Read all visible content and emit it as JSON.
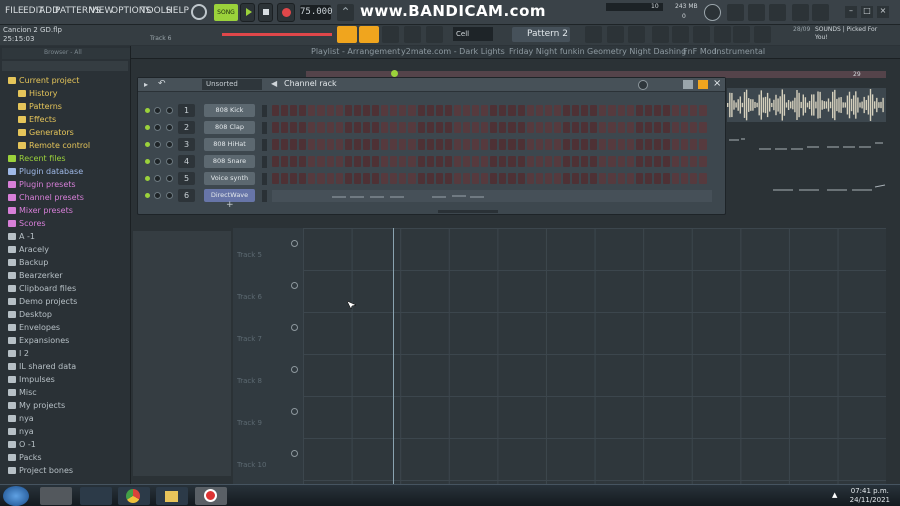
{
  "menu": {
    "items": [
      "FILE",
      "EDIT",
      "ADD",
      "PATTERNS",
      "VIEW",
      "OPTIONS",
      "TOOLS",
      "HELP"
    ]
  },
  "toolbar": {
    "mode": "SONG",
    "tempo": "75.000",
    "watermark": "www.BANDICAM.com",
    "cpu": "10",
    "ram": "243 MB",
    "ram2": "0",
    "pattern": "Pattern 2",
    "snap": "Cell"
  },
  "song": {
    "filename": "Cancion 2 GD.flp",
    "time": "25:15:03",
    "track": "Track 6"
  },
  "news": {
    "count": "28/09",
    "text": "SOUNDS | Picked For You!"
  },
  "browser": {
    "header": "Browser - All",
    "items": [
      {
        "label": "Current project",
        "color": "#e5c55a"
      },
      {
        "label": "History",
        "color": "#e5c55a"
      },
      {
        "label": "Patterns",
        "color": "#e5c55a"
      },
      {
        "label": "Effects",
        "color": "#e5c55a"
      },
      {
        "label": "Generators",
        "color": "#e5c55a"
      },
      {
        "label": "Remote control",
        "color": "#e5c55a"
      },
      {
        "label": "Recent files",
        "color": "#9bd23b"
      },
      {
        "label": "Plugin database",
        "color": "#9fb9e8"
      },
      {
        "label": "Plugin presets",
        "color": "#d77fd8"
      },
      {
        "label": "Channel presets",
        "color": "#d77fd8"
      },
      {
        "label": "Mixer presets",
        "color": "#d77fd8"
      },
      {
        "label": "Scores",
        "color": "#d77fd8"
      },
      {
        "label": "A -1",
        "color": "#b7c0c6"
      },
      {
        "label": "Aracely",
        "color": "#b7c0c6"
      },
      {
        "label": "Backup",
        "color": "#b7c0c6"
      },
      {
        "label": "Bearzerker",
        "color": "#b7c0c6"
      },
      {
        "label": "Clipboard files",
        "color": "#b7c0c6"
      },
      {
        "label": "Demo projects",
        "color": "#b7c0c6"
      },
      {
        "label": "Desktop",
        "color": "#b7c0c6"
      },
      {
        "label": "Envelopes",
        "color": "#b7c0c6"
      },
      {
        "label": "Expansiones",
        "color": "#b7c0c6"
      },
      {
        "label": "I 2",
        "color": "#b7c0c6"
      },
      {
        "label": "IL shared data",
        "color": "#b7c0c6"
      },
      {
        "label": "Impulses",
        "color": "#b7c0c6"
      },
      {
        "label": "Misc",
        "color": "#b7c0c6"
      },
      {
        "label": "My projects",
        "color": "#b7c0c6"
      },
      {
        "label": "nya",
        "color": "#b7c0c6"
      },
      {
        "label": "nya",
        "color": "#b7c0c6"
      },
      {
        "label": "O -1",
        "color": "#b7c0c6"
      },
      {
        "label": "Packs",
        "color": "#b7c0c6"
      },
      {
        "label": "Project bones",
        "color": "#b7c0c6"
      }
    ]
  },
  "playlist": {
    "title": "Playlist - Arrangement",
    "tabs": [
      "y2mate.com - Dark Lights",
      "Friday Night funkin",
      "Geometry Night Dashing",
      "FnF Mod",
      "Instrumental"
    ],
    "bar_end": "29",
    "tracks": [
      "Track 5",
      "Track 6",
      "Track 7",
      "Track 8",
      "Track 9",
      "Track 10"
    ]
  },
  "rack": {
    "title": "Channel rack",
    "filter": "Unsorted",
    "channels": [
      {
        "num": "1",
        "name": "808 Kick"
      },
      {
        "num": "2",
        "name": "808 Clap"
      },
      {
        "num": "3",
        "name": "808 HiHat"
      },
      {
        "num": "4",
        "name": "808 Snare"
      },
      {
        "num": "5",
        "name": "Voice synth"
      },
      {
        "num": "6",
        "name": "DirectWave"
      }
    ]
  },
  "taskbar": {
    "time": "07:41 p.m.",
    "date": "24/11/2021"
  }
}
